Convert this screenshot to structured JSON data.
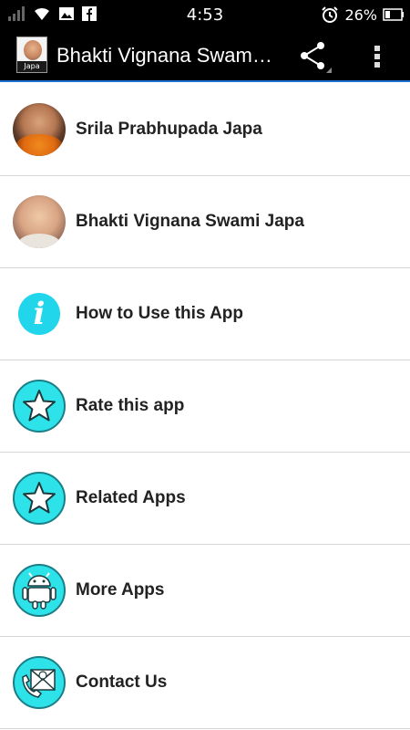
{
  "status_bar": {
    "time": "4:53",
    "battery_percent": "26%",
    "icons": [
      "signal-icon",
      "wifi-icon",
      "image-icon",
      "facebook-icon",
      "alarm-icon",
      "battery-icon"
    ]
  },
  "action_bar": {
    "logo_tag": "Japa",
    "title": "Bhakti Vignana Swam…",
    "icons": [
      "share-icon",
      "overflow-menu-icon"
    ]
  },
  "menu": {
    "items": [
      {
        "label": "Srila Prabhupada Japa",
        "icon": "prabhupada-photo"
      },
      {
        "label": "Bhakti Vignana Swami Japa",
        "icon": "swami-photo"
      },
      {
        "label": "How to Use this App",
        "icon": "info-icon"
      },
      {
        "label": "Rate this app",
        "icon": "star-icon"
      },
      {
        "label": "Related Apps",
        "icon": "star-icon"
      },
      {
        "label": "More Apps",
        "icon": "android-icon"
      },
      {
        "label": "Contact Us",
        "icon": "contact-icon"
      }
    ]
  },
  "colors": {
    "accent": "#1e6fd0",
    "icon_fill": "#2ee2ea",
    "status_bar": "#000000"
  }
}
